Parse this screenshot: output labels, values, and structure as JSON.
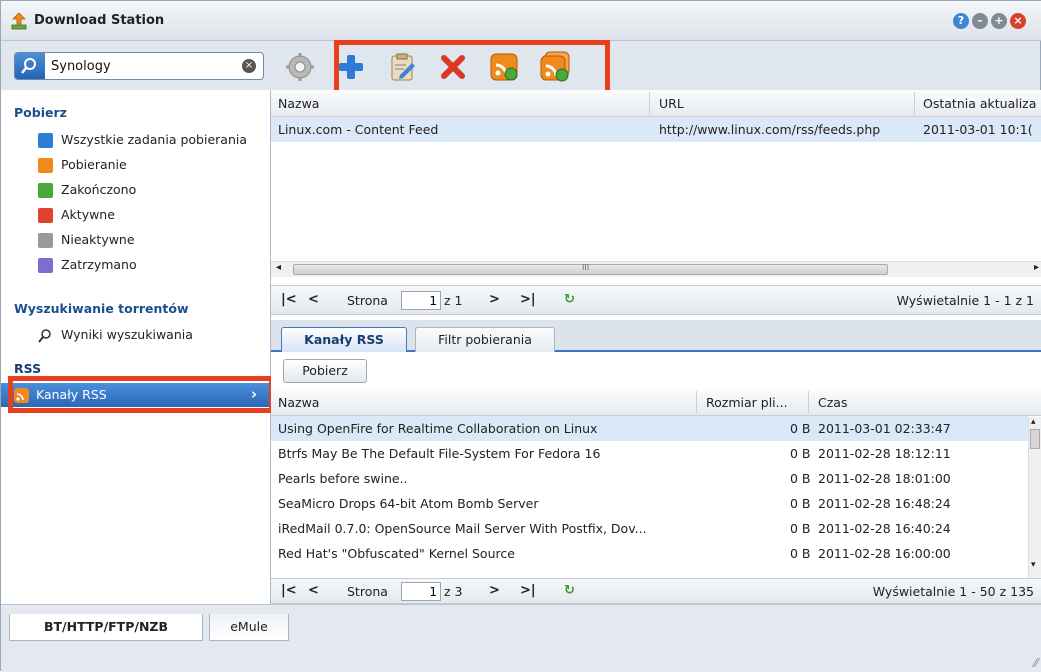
{
  "app": {
    "title": "Download Station"
  },
  "search": {
    "value": "Synology",
    "placeholder": ""
  },
  "sidebar": {
    "sections": [
      {
        "label": "Pobierz"
      },
      {
        "label": "Wyszukiwanie torrentów"
      },
      {
        "label": "RSS"
      }
    ],
    "items": [
      {
        "label": "Wszystkie zadania pobierania",
        "icon": "list-icon",
        "color": "#2d7fd6"
      },
      {
        "label": "Pobieranie",
        "icon": "download-arrow-icon",
        "color": "#f08a1c"
      },
      {
        "label": "Zakończono",
        "icon": "checkmark-icon",
        "color": "#48a93a"
      },
      {
        "label": "Aktywne",
        "icon": "active-icon",
        "color": "#e0432d"
      },
      {
        "label": "Nieaktywne",
        "icon": "inactive-icon",
        "color": "#9a9a9a"
      },
      {
        "label": "Zatrzymano",
        "icon": "pause-icon",
        "color": "#7a6fd1"
      },
      {
        "label": "Wyniki wyszukiwania",
        "icon": "search-icon"
      },
      {
        "label": "Kanały RSS",
        "icon": "rss-icon",
        "color": "#f07d1a"
      }
    ]
  },
  "feeds_grid": {
    "columns": [
      "Nazwa",
      "URL",
      "Ostatnia aktualiza"
    ],
    "rows": [
      {
        "name": "Linux.com - Content Feed",
        "url": "http://www.linux.com/rss/feeds.php",
        "updated": "2011-03-01 10:1("
      }
    ],
    "scroll_glyph": "III"
  },
  "pager_top": {
    "label_page": "Strona",
    "page": "1",
    "of": "z 1",
    "display": "Wyświetalnie 1 - 1 z 1"
  },
  "tabs": [
    "Kanały RSS",
    "Filtr pobierania"
  ],
  "download_button": "Pobierz",
  "items_grid": {
    "columns": [
      "Nazwa",
      "Rozmiar pli...",
      "Czas"
    ],
    "rows": [
      {
        "name": "Using OpenFire for Realtime Collaboration on Linux",
        "size": "0 B",
        "time": "2011-03-01 02:33:47"
      },
      {
        "name": "Btrfs May Be The Default File-System For Fedora 16",
        "size": "0 B",
        "time": "2011-02-28 18:12:11"
      },
      {
        "name": "Pearls before swine..",
        "size": "0 B",
        "time": "2011-02-28 18:01:00"
      },
      {
        "name": "SeaMicro Drops 64-bit Atom Bomb Server",
        "size": "0 B",
        "time": "2011-02-28 16:48:24"
      },
      {
        "name": "iRedMail 0.7.0: OpenSource Mail Server With Postfix, Dov...",
        "size": "0 B",
        "time": "2011-02-28 16:40:24"
      },
      {
        "name": "Red Hat's \"Obfuscated\" Kernel Source",
        "size": "0 B",
        "time": "2011-02-28 16:00:00"
      }
    ]
  },
  "pager_bottom": {
    "label_page": "Strona",
    "page": "1",
    "of": "z 3",
    "display": "Wyświetalnie 1 - 50 z 135"
  },
  "bottom_tabs": [
    "BT/HTTP/FTP/NZB",
    "eMule"
  ],
  "colors": {
    "accent": "#2b67b7",
    "highlight": "#e6401c",
    "selected_row": "#dbe8f7"
  }
}
